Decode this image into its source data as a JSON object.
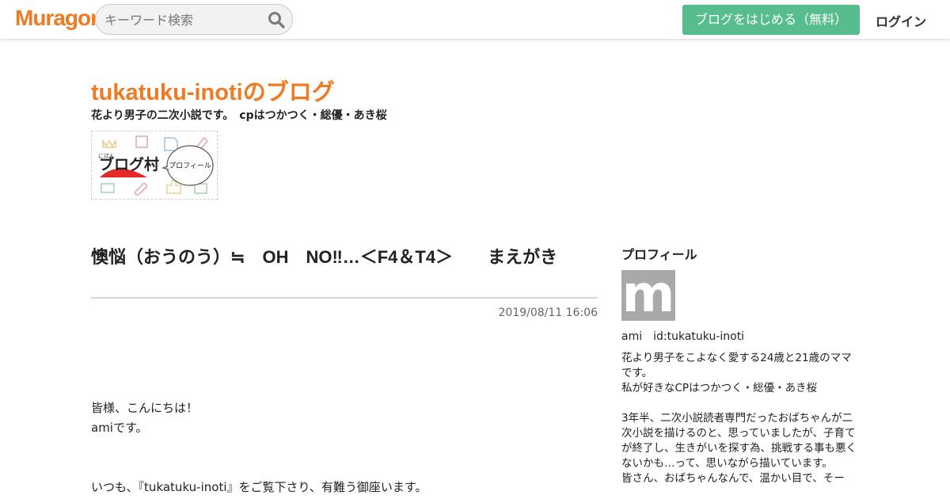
{
  "nav": {
    "logo": "Muragon",
    "search_placeholder": "キーワード検索",
    "search_icon": "search-icon",
    "start_button": "ブログをはじめる（無料）",
    "login": "ログイン"
  },
  "colors": {
    "accent": "#ef7a21",
    "start_button_bg": "#58bd8e"
  },
  "blog": {
    "title": "tukatuku-inotiのブログ",
    "description": "花より男子の二次小説です。　cpはつかつく・総優・あき桜",
    "banner": {
      "small_label": "にほん",
      "main_label": "ブログ村",
      "bubble_label": "プロフィール"
    }
  },
  "post": {
    "title": "懊悩（おうのう）≒　OH　NO‼…＜F4＆T4＞　　まえがき",
    "date": "2019/08/11 16:06",
    "body": [
      "皆様、こんにちは！",
      "amiです。",
      "",
      "",
      "いつも、『tukatuku-inoti』をご覧下さり、有難う御座います。"
    ]
  },
  "sidebar": {
    "heading": "プロフィール",
    "avatar_letter": "m",
    "user": "ami　id:tukatuku-inoti",
    "bio": [
      "花より男子をこよなく愛する24歳と21歳のママです。",
      "私が好きなCPはつかつく・総優・あき桜",
      "",
      "3年半、二次小説読者専門だったおばちゃんが二次小説を描けるのと、思っていましたが、子育てが終了し、生きがいを探す為、挑戦する事も悪くないかも…って、思いながら描いています。",
      "皆さん、おばちゃんなんで、温かい目で、そー"
    ]
  }
}
